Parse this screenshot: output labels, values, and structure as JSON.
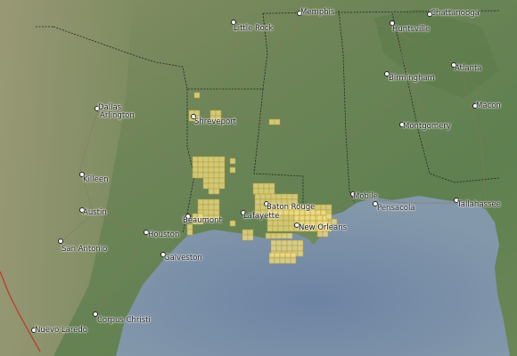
{
  "map": {
    "cities": [
      {
        "id": "memphis",
        "label": "Memphis"
      },
      {
        "id": "chattanooga",
        "label": "Chattanooga"
      },
      {
        "id": "little-rock",
        "label": "Little Rock"
      },
      {
        "id": "huntsville",
        "label": "Huntsville"
      },
      {
        "id": "atlanta",
        "label": "Atlanta"
      },
      {
        "id": "birmingham",
        "label": "Birmingham"
      },
      {
        "id": "macon",
        "label": "Macon"
      },
      {
        "id": "dallas",
        "label": "Dallas"
      },
      {
        "id": "arlington",
        "label": "Arlington"
      },
      {
        "id": "shreveport",
        "label": "Shreveport"
      },
      {
        "id": "montgomery",
        "label": "Montgomery"
      },
      {
        "id": "killeen",
        "label": "Killeen"
      },
      {
        "id": "mobile",
        "label": "Mobile"
      },
      {
        "id": "pensacola",
        "label": "Pensacola"
      },
      {
        "id": "tallahassee",
        "label": "Tallahassee"
      },
      {
        "id": "austin",
        "label": "Austin"
      },
      {
        "id": "beaumont",
        "label": "Beaumont"
      },
      {
        "id": "lafayette",
        "label": "Lafayette"
      },
      {
        "id": "baton-rouge",
        "label": "Baton Rouge"
      },
      {
        "id": "new-orleans",
        "label": "New Orleans"
      },
      {
        "id": "houston",
        "label": "Houston"
      },
      {
        "id": "san-antonio",
        "label": "San Antonio"
      },
      {
        "id": "galveston",
        "label": "Galveston"
      },
      {
        "id": "corpus-christi",
        "label": "Corpus Christi"
      },
      {
        "id": "nuevo-laredo",
        "label": "Nuevo Laredo"
      }
    ],
    "colors": {
      "land": "#6f8a5a",
      "water": "#7d93a8",
      "coverage_fill": "#f2e08a",
      "coverage_stroke": "#b89a2a",
      "border": "#222222",
      "road": "#8a7560"
    }
  }
}
